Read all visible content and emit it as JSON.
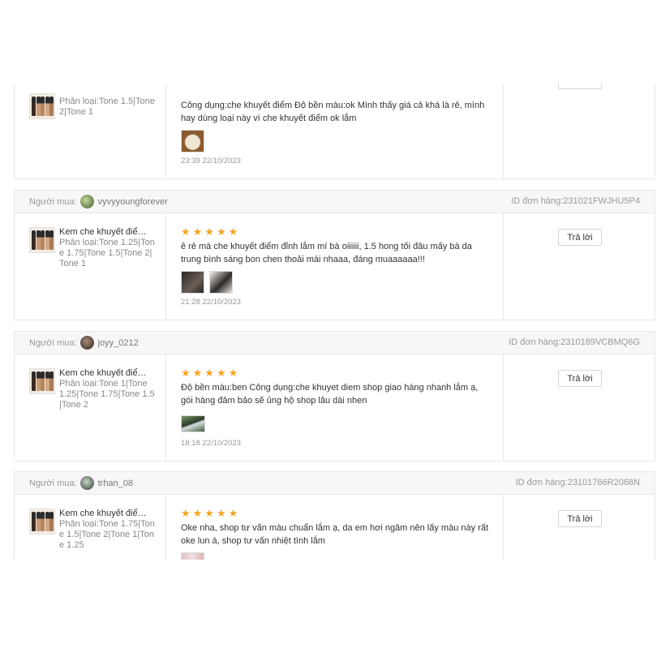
{
  "labels": {
    "buyer": "Người mua:",
    "reply": "Trả lời"
  },
  "reviews": [
    {
      "username": "",
      "order_id": "",
      "product_name": "",
      "variant": "Phân loại:Tone 1.5|Tone 2|Tone 1",
      "stars": "★★★★★",
      "text": "Công dụng:che khuyết điểm Độ bền màu:ok Mình thấy giá cả khá là rẻ, mình hay dùng loại này vì che khuyết điểm ok lắm",
      "time": "23:39 22/10/2023",
      "photos": [
        "#b88a5a"
      ]
    },
    {
      "username": "vyvyyoungforever",
      "order_id": "ID đơn hàng:231021FWJHU5P4",
      "product_name": "Kem che khuyết điểm Tone 1.25",
      "variant": "Phân loại:Tone 1.25|Tone 1.75|Tone 1.5|Tone 2|Tone 1",
      "stars": "★★★★★",
      "text": "ê rẻ mà che khuyết điểm đỉnh lắm mí bà oiiiiii, 1.5 hong tối đâu mấy bà da trung bình sáng bon chen thoải mái nhaaa, đáng muaaaaaa!!!",
      "time": "21:28 22/10/2023",
      "photos": [
        "#3a3431",
        "#d9d4cf"
      ]
    },
    {
      "username": "joyy_0212",
      "order_id": "ID đơn hàng:2310189VCBMQ6G",
      "product_name": "Kem che khuyết điểm Tone 1",
      "variant": "Phân loại:Tone 1|Tone 1.25|Tone 1.75|Tone 1.5|Tone 2",
      "stars": "★★★★★",
      "text": "Độ bền màu:ben Công dụng:che khuyet diem shop giao hàng nhanh lắm ạ, gói hàng đảm bảo sẽ ủng hộ shop lâu dài nhen",
      "time": "18:18 22/10/2023",
      "photos": [
        "#4a6a3e"
      ]
    },
    {
      "username": "trhan_08",
      "order_id": "ID đơn hàng:23101766R2068N",
      "product_name": "Kem che khuyết điểm Tone 1.75",
      "variant": "Phân loại:Tone 1.75|Tone 1.5|Tone 2|Tone 1|Tone 1.25",
      "stars": "★★★★★",
      "text": "Oke nha, shop tư vấn màu chuẩn lắm ạ, da em hơi ngăm nên lấy màu này rất oke lun á, shop tư vấn nhiệt tình lắm",
      "time": "",
      "photos": [
        "#e8c8cc"
      ]
    }
  ]
}
